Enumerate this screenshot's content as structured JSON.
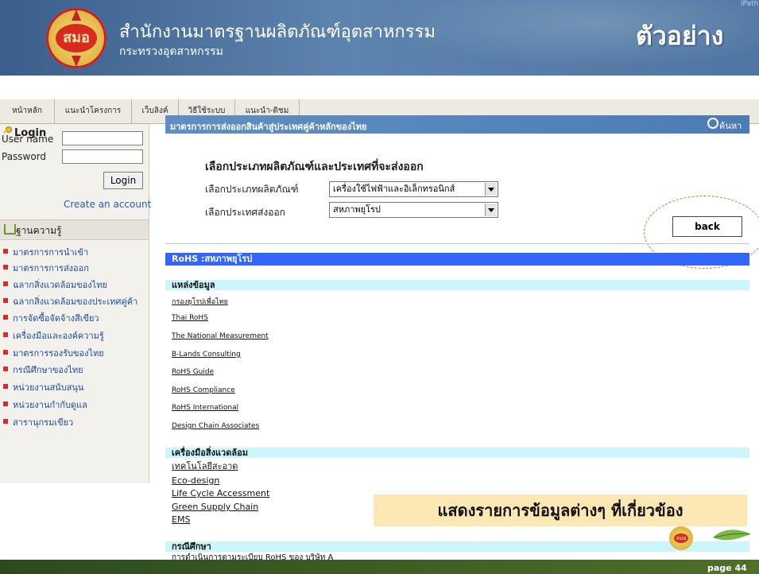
{
  "header": {
    "logo_text": "สมอ",
    "org_name": "สำนักงานมาตรฐานผลิตภัณฑ์อุตสาหกรรม",
    "ministry": "กระทรวงอุตสาหกรรม",
    "sample_label": "ตัวอย่าง",
    "corner_text": "iPath"
  },
  "nav": {
    "items": [
      "หน้าหลัก",
      "แนะนำโครงการ",
      "เว็บลิงค์",
      "วิธีใช้ระบบ",
      "แนะนำ-ติชม"
    ]
  },
  "login": {
    "title": "Login",
    "username_label": "User name",
    "password_label": "Password",
    "login_button": "Login",
    "create_account": "Create an account"
  },
  "knowledge": {
    "title": "ฐานความรู้",
    "items": [
      "มาตรการการนำเข้า",
      "มาตรการการส่งออก",
      "ฉลากสิ่งแวดล้อมของไทย",
      "ฉลากสิ่งแวดล้อมของประเทศคู่ค้า",
      "การจัดซื้อจัดจ้างสีเขียว",
      "เครื่องมือและองค์ความรู้",
      "มาตรการรองรับของไทย",
      "กรณีศึกษาของไทย",
      "หน่วยงานสนับสนุน",
      "หน่วยงานกำกับดูแล",
      "สารานุกรมเขียว"
    ]
  },
  "main": {
    "bar_title": "มาตรการการส่งออกสินค้าสู่ประเทศคู่ค้าหลักของไทย",
    "search_label": "ค้นหา",
    "select_title": "เลือกประเภทผลิตภัณฑ์และประเทศที่จะส่งออก",
    "product_label": "เลือกประเภทผลิตภัณฑ์",
    "product_value": "เครื่องใช้ไฟฟ้าและอิเล็กทรอนิกส์",
    "country_label": "เลือกประเทศส่งออก",
    "country_value": "สหภาพยุโรป",
    "back_button": "back",
    "rohs_title": "RoHS :สหภาพยุโรป",
    "sources_title": "แหล่งข้อมูล",
    "sources": [
      "กรองยุโรปเพื่อไทย",
      "Thai RoHS",
      "The National Measurement",
      " B-Lands Consulting",
      "RoHS Guide ",
      "RoHS Compliance",
      "RoHS International ",
      "Design Chain Associates"
    ],
    "tools_title": "เครื่องมือสิ่งแวดล้อม",
    "tools": [
      "เทคโนโลยีสะอาด",
      "Eco-design",
      "Life Cycle Accessment",
      "Green Supply Chain",
      "EMS"
    ],
    "case_title": "กรณีศึกษา",
    "case_item": "การดำเนินการตามระเบียบ RoHS ของ บริษัท A"
  },
  "callout": "แสดงรายการข้อมูลต่างๆ ที่เกี่ยวข้อง",
  "footer": {
    "page": "page 44"
  },
  "colors": {
    "header_blue": "#4f76a2",
    "rohs_bar": "#3366ff",
    "section_bar": "#ccf6fb",
    "callout_bg": "#fde8b5",
    "link_blue": "#204aa0"
  }
}
